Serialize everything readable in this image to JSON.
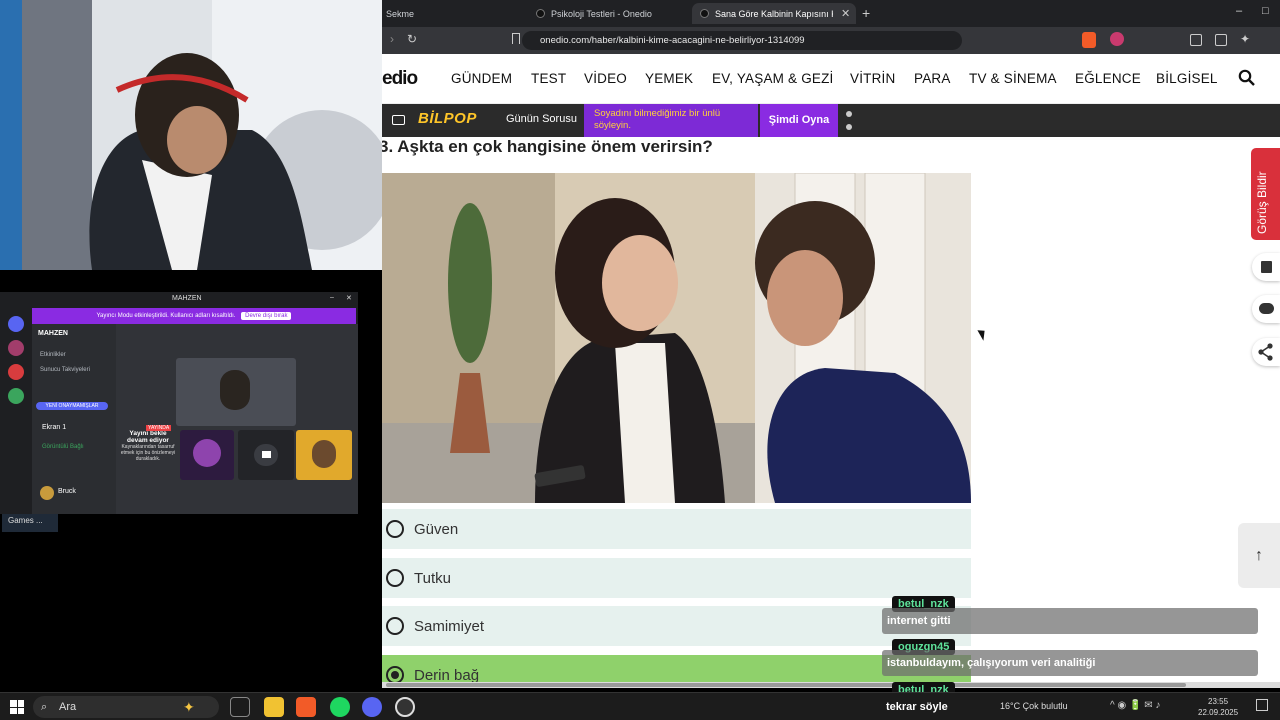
{
  "browser": {
    "tabs": [
      {
        "label": "Sekme"
      },
      {
        "label": "Psikoloji Testleri - Onedio"
      },
      {
        "label": "Sana Göre Kalbinin Kapısını Kim"
      }
    ],
    "url": "onedio.com/haber/kalbini-kime-acacagini-ne-belirliyor-1314099",
    "window_controls": [
      "–",
      "□",
      "✕"
    ]
  },
  "site": {
    "logo": "edio",
    "nav": [
      "GÜNDEM",
      "TEST",
      "VİDEO",
      "YEMEK",
      "EV, YAŞAM & GEZİ",
      "VİTRİN",
      "PARA",
      "TV & SİNEMA",
      "EĞLENCE",
      "BİLGİSEL"
    ],
    "promo": {
      "brand": "BİLPOP",
      "daily": "Günün Sorusu",
      "teaser": "Soyadını bilmediğimiz bir ünlü söyleyin.",
      "cta": "Şimdi Oyna"
    },
    "question": "3. Aşkta en çok hangisine önem verirsin?",
    "options": [
      {
        "label": "Güven",
        "selected": false
      },
      {
        "label": "Tutku",
        "selected": false
      },
      {
        "label": "Samimiyet",
        "selected": false
      },
      {
        "label": "Derin bağ",
        "selected": true
      }
    ],
    "feedback": "Görüş Bildir",
    "colors": {
      "feedback": "#d9303b",
      "selected_option": "#8fd16b",
      "option_bg": "#e6f1ee",
      "promo_purple": "#8a2be2"
    }
  },
  "chat": [
    {
      "user": "betul_nzk",
      "message": "internet gitti"
    },
    {
      "user": "oguzgn45",
      "message": "istanbuldayım, çalışıyorum veri analitiği"
    },
    {
      "user": "betul_nzk",
      "message": "tekrar söyle"
    }
  ],
  "discord": {
    "title": "MAHZEN",
    "banner": "Yayıncı Modu etkinleştirildi. Kullanıcı adları kısaltıldı.",
    "banner_button": "Devre dışı bırak",
    "server": "MAHZEN",
    "channels": [
      "Etkinlikler",
      "Sunucu Takviyeleri"
    ],
    "new_mentions": "YENİ ONAYMAMIŞLAR",
    "voice_channel": "Ekran 1",
    "voice_status": "Görüntülü Bağlı",
    "user": "Bruck",
    "paused": "Yayını bekle devam ediyor",
    "paused_sub": "Kaynaklarından tasarruf etmek için bu önizlemeyi durakladık.",
    "live_badge": "YAYINDA",
    "games": "Games ..."
  },
  "taskbar": {
    "search": "Ara",
    "weather": "16°C  Çok bulutlu",
    "time": "23:55",
    "date": "22.09.2025"
  }
}
